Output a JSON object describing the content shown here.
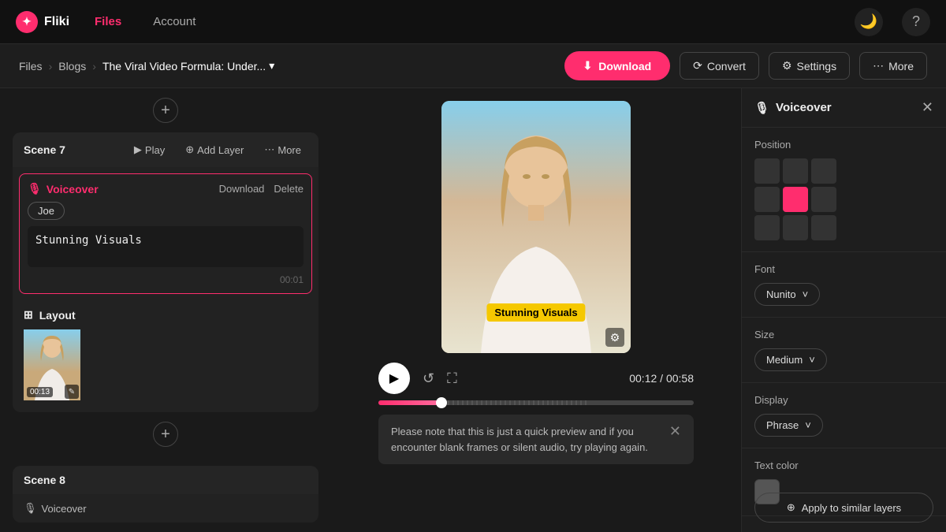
{
  "app": {
    "name": "Fliki",
    "logo_icon": "✦"
  },
  "nav": {
    "items": [
      {
        "label": "Files",
        "active": true
      },
      {
        "label": "Account",
        "active": false
      }
    ],
    "moon_icon": "🌙",
    "help_icon": "?"
  },
  "breadcrumb": {
    "items": [
      "Files",
      "Blogs",
      "The Viral Video Formula: Under..."
    ],
    "chevron": "›",
    "dropdown_icon": "▾"
  },
  "toolbar": {
    "download_icon": "⬇",
    "download_label": "Download",
    "convert_icon": "⟳",
    "convert_label": "Convert",
    "settings_icon": "⚙",
    "settings_label": "Settings",
    "more_icon": "⋯",
    "more_label": "More"
  },
  "scene7": {
    "title": "Scene 7",
    "play_icon": "▶",
    "play_label": "Play",
    "add_layer_icon": "⊕",
    "add_layer_label": "Add Layer",
    "more_icon": "⋯",
    "more_label": "More",
    "voiceover": {
      "mic_icon": "🎙",
      "title": "Voiceover",
      "download_label": "Download",
      "delete_label": "Delete",
      "voice_name": "Joe",
      "text": "Stunning Visuals",
      "timestamp": "00:01"
    },
    "layout": {
      "icon": "⊞",
      "title": "Layout",
      "thumb_time": "00:13",
      "edit_icon": "✎"
    }
  },
  "scene8": {
    "title": "Scene 8",
    "voiceover_icon": "🎙",
    "voiceover_label": "Voiceover"
  },
  "video": {
    "subtitle_text": "Stunning Visuals",
    "settings_icon": "⚙",
    "current_time": "00:12",
    "total_time": "00:58",
    "progress_percent": 20,
    "play_icon": "▶",
    "replay_icon": "↺",
    "fullscreen_icon": "⛶"
  },
  "notification": {
    "text": "Please note that this is just a quick preview and if you encounter blank frames or silent audio, try playing again.",
    "close_icon": "✕"
  },
  "right_panel": {
    "title": "Voiceover",
    "mic_icon": "🎙",
    "close_icon": "✕",
    "sections": {
      "position": {
        "label": "Position",
        "active_cell": 4
      },
      "font": {
        "label": "Font",
        "value": "Nunito",
        "chevron": "˅"
      },
      "size": {
        "label": "Size",
        "value": "Medium",
        "chevron": "˅"
      },
      "display": {
        "label": "Display",
        "value": "Phrase",
        "chevron": "˅"
      },
      "text_color": {
        "label": "Text color"
      }
    },
    "apply_btn": {
      "icon": "⊕",
      "label": "Apply to similar layers"
    }
  }
}
